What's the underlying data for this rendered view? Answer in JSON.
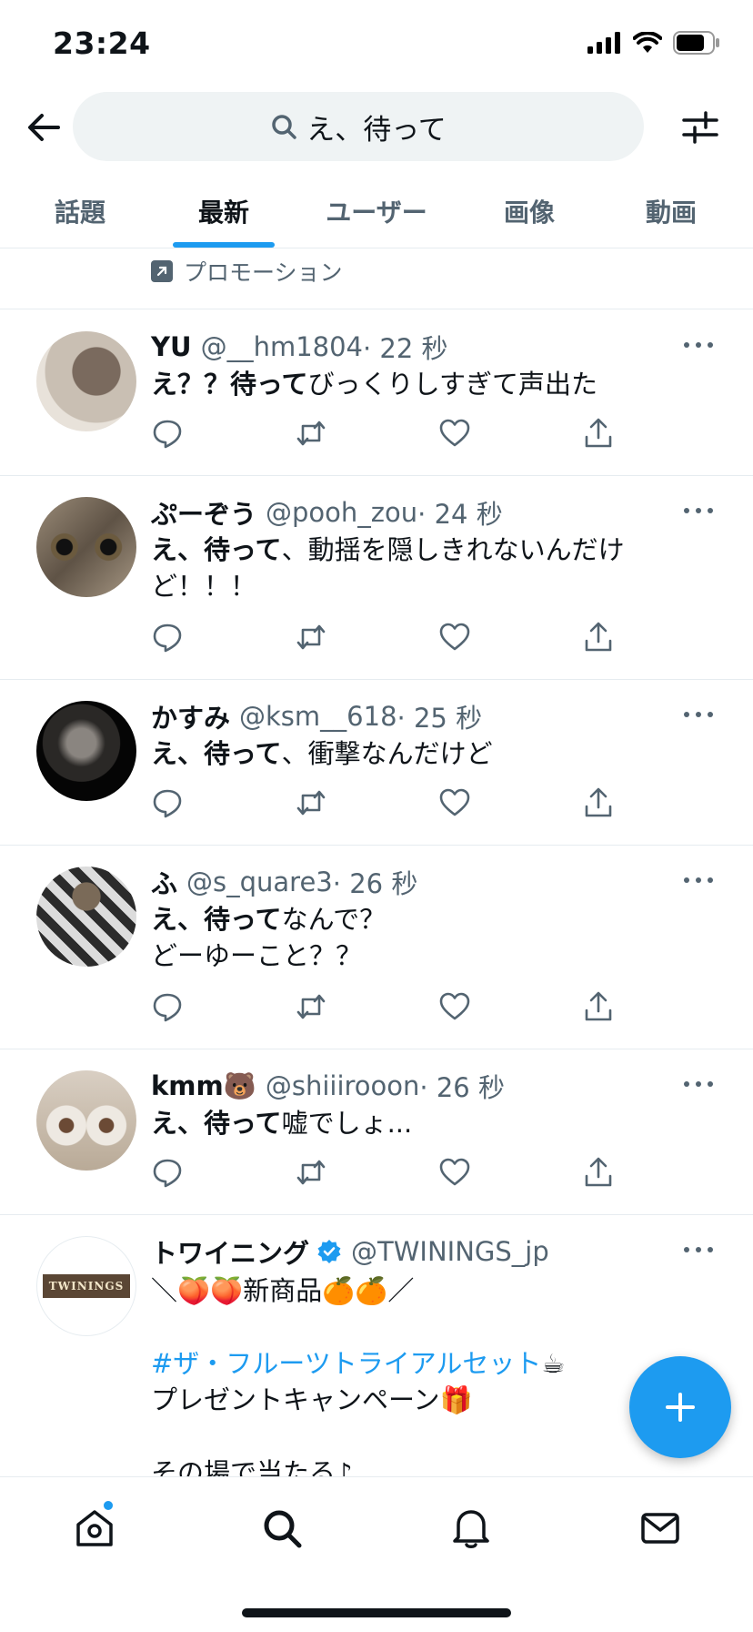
{
  "status_bar": {
    "time": "23:24"
  },
  "search": {
    "query": "え、待って"
  },
  "tabs": [
    {
      "label": "話題",
      "active": false
    },
    {
      "label": "最新",
      "active": true
    },
    {
      "label": "ユーザー",
      "active": false
    },
    {
      "label": "画像",
      "active": false
    },
    {
      "label": "動画",
      "active": false
    }
  ],
  "promo_label": "プロモーション",
  "tweets": [
    {
      "name": "YU",
      "handle": "@__hm1804",
      "time": "· 22 秒",
      "bold": "え？？待って",
      "rest": "びっくりしすぎて声出た"
    },
    {
      "name": "ぷーぞう",
      "handle": "@pooh_zou",
      "time": "· 24 秒",
      "bold": "え、待って",
      "rest": "、動揺を隠しきれないんだけど！！！"
    },
    {
      "name": "かすみ",
      "handle": "@ksm__618",
      "time": "· 25 秒",
      "bold": "え、待って",
      "rest": "、衝撃なんだけど"
    },
    {
      "name": "ふ",
      "handle": "@s_quare3",
      "time": "· 26 秒",
      "bold": "え、待って",
      "rest": "なんで？",
      "line2": "どーゆーこと？？"
    },
    {
      "name": "kmm🐻",
      "handle": "@shiiirooon",
      "time": "· 26 秒",
      "bold": "え、待って",
      "rest": "嘘でしょ..."
    },
    {
      "name": "トワイニング",
      "handle": "@TWININGS_jp",
      "line1": "＼🍑🍑新商品🍊🍊／",
      "hashtag": "#ザ・フルーツトライアルセット",
      "hashtag_emoji": "☕",
      "line3": "プレゼントキャンペーン🎁",
      "line4": "その場で当たる♪",
      "logo_text": "TWININGS"
    }
  ],
  "colors": {
    "accent": "#1d9bf0",
    "text": "#0f1419",
    "muted": "#536471",
    "divider": "#e6ecf0"
  },
  "icons": [
    "back-arrow-icon",
    "search-icon",
    "filter-icon",
    "promoted-icon",
    "reply-icon",
    "retweet-icon",
    "like-icon",
    "share-icon",
    "more-icon",
    "verified-icon",
    "compose-icon",
    "home-icon",
    "explore-icon",
    "notifications-icon",
    "messages-icon"
  ]
}
